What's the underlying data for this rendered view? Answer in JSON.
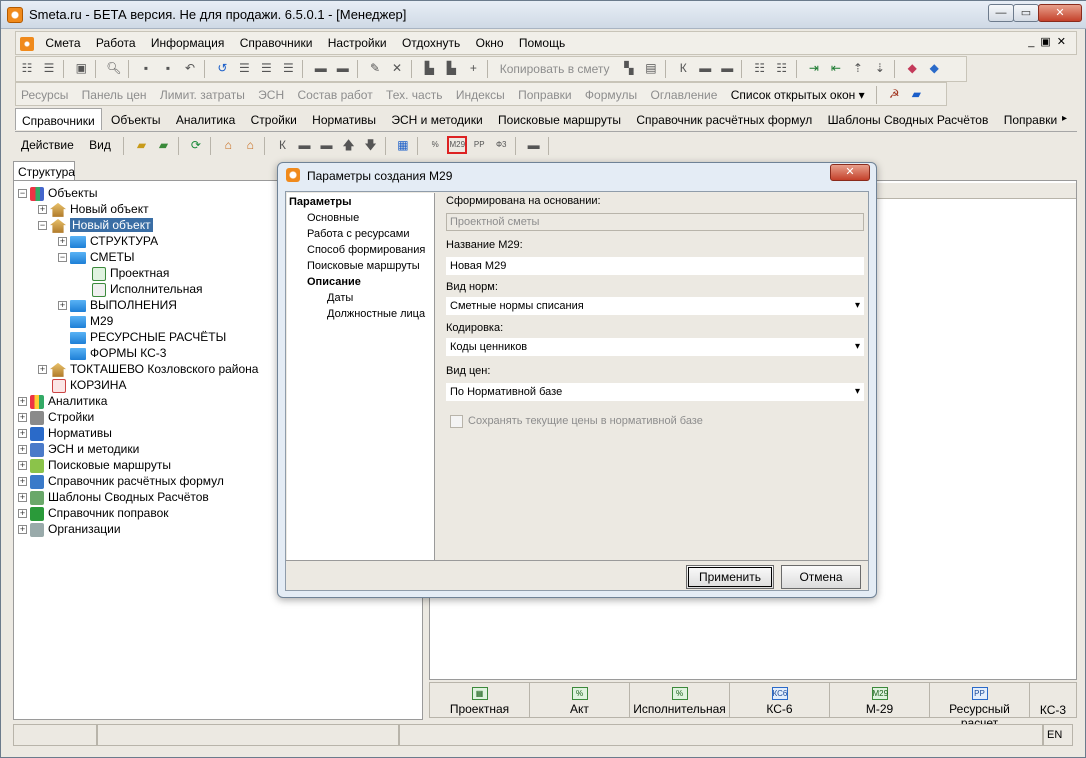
{
  "window": {
    "title": "Smeta.ru - БЕТА версия. Не для продажи.  6.5.0.1   - [Менеджер]"
  },
  "menu": [
    "Смета",
    "Работа",
    "Информация",
    "Справочники",
    "Настройки",
    "Отдохнуть",
    "Окно",
    "Помощь"
  ],
  "toolbar2": {
    "copy_label": "Копировать в смету"
  },
  "toolbar3": [
    "Ресурсы",
    "Панель цен",
    "Лимит. затраты",
    "ЭСН",
    "Состав работ",
    "Тех. часть",
    "Индексы",
    "Поправки",
    "Формулы",
    "Оглавление"
  ],
  "open_windows_label": "Список открытых окон",
  "tabs": [
    "Справочники",
    "Объекты",
    "Аналитика",
    "Стройки",
    "Нормативы",
    "ЭСН и методики",
    "Поисковые маршруты",
    "Справочник расчётных формул",
    "Шаблоны Сводных Расчётов",
    "Поправки"
  ],
  "actionbar": {
    "action": "Действие",
    "view": "Вид"
  },
  "left_tab": "Структура",
  "tree": {
    "root": "Объекты",
    "new_object_1": "Новый объект",
    "new_object_2": "Новый объект",
    "structure": "СТРУКТУРА",
    "estimates": "СМЕТЫ",
    "design": "Проектная",
    "executive": "Исполнительная",
    "performance": "ВЫПОЛНЕНИЯ",
    "m29": "М29",
    "resource_calc": "РЕСУРСНЫЕ РАСЧЁТЫ",
    "ks3_forms": "ФОРМЫ КС-3",
    "toktashevo": "ТОКТАШЕВО Козловского района",
    "trash": "КОРЗИНА",
    "analytics": "Аналитика",
    "constructions": "Стройки",
    "normatives": "Нормативы",
    "esn": "ЭСН и методики",
    "routes": "Поисковые маршруты",
    "formulas": "Справочник расчётных формул",
    "templates": "Шаблоны Сводных Расчётов",
    "corrections": "Справочник поправок",
    "organizations": "Организации"
  },
  "dialog": {
    "title": "Параметры создания М29",
    "nav": {
      "params": "Параметры",
      "basic": "Основные",
      "resources": "Работа с ресурсами",
      "method": "Способ формирования",
      "routes": "Поисковые маршруты",
      "description": "Описание",
      "dates": "Даты",
      "officials": "Должностные лица"
    },
    "based_on_label": "Сформирована на основании:",
    "based_on_value": "Проектной сметы",
    "name_label": "Название М29:",
    "name_value": "Новая М29",
    "norm_type_label": "Вид норм:",
    "norm_type_value": "Сметные нормы списания",
    "encoding_label": "Кодировка:",
    "encoding_value": "Коды ценников",
    "price_type_label": "Вид цен:",
    "price_type_value": "По Нормативной базе",
    "keep_prices_label": "Сохранять текущие цены в нормативной базе",
    "apply": "Применить",
    "cancel": "Отмена"
  },
  "bottom_tabs": [
    {
      "label": "Проектная",
      "icon": "▦"
    },
    {
      "label": "Акт",
      "icon": "%"
    },
    {
      "label": "Исполнительная",
      "icon": "%"
    },
    {
      "label": "КС-6",
      "icon": "КС6"
    },
    {
      "label": "М-29",
      "icon": "М29"
    },
    {
      "label": "Ресурсный расчет",
      "icon": "РР"
    },
    {
      "label": "КС-3",
      "icon": ""
    }
  ],
  "status": {
    "lang": "EN"
  }
}
